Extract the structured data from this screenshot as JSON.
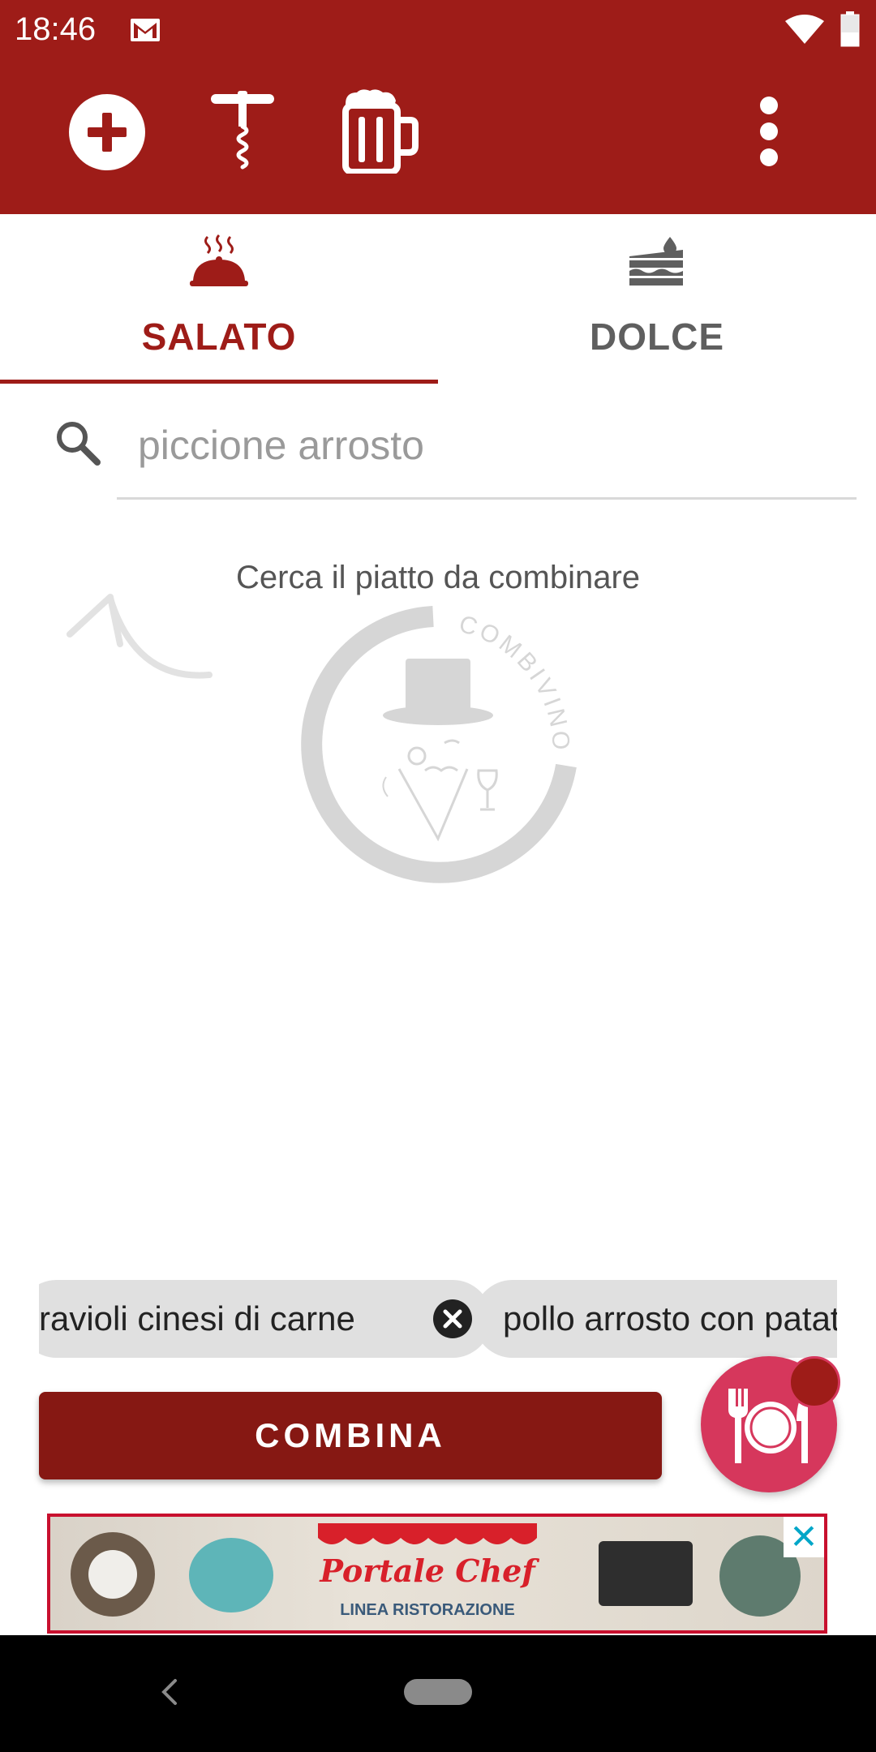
{
  "status_bar": {
    "time": "18:46"
  },
  "toolbar": {
    "icons": [
      "add-icon",
      "corkscrew-icon",
      "beer-mug-icon",
      "more-vert-icon"
    ]
  },
  "tabs": [
    {
      "label": "SALATO",
      "icon": "covered-dish-icon",
      "selected": true
    },
    {
      "label": "DOLCE",
      "icon": "cake-slice-icon",
      "selected": false
    }
  ],
  "search": {
    "placeholder": "piccione arrosto",
    "value": ""
  },
  "empty_state": {
    "hint": "Cerca il piatto da combinare",
    "logo_text": "COMBIVINO"
  },
  "chips": [
    {
      "label": "ravioli cinesi di carne",
      "removable": true
    },
    {
      "label": "pollo arrosto con patate",
      "removable": false
    }
  ],
  "combine_button": {
    "label": "COMBINA"
  },
  "ad": {
    "brand": "Portale Chef",
    "tagline": "LINEA RISTORAZIONE",
    "close_label": "✕"
  },
  "colors": {
    "primary": "#9e1c18",
    "button": "#861813",
    "fab": "#d6375c",
    "tab_inactive": "#5f5f5f"
  }
}
